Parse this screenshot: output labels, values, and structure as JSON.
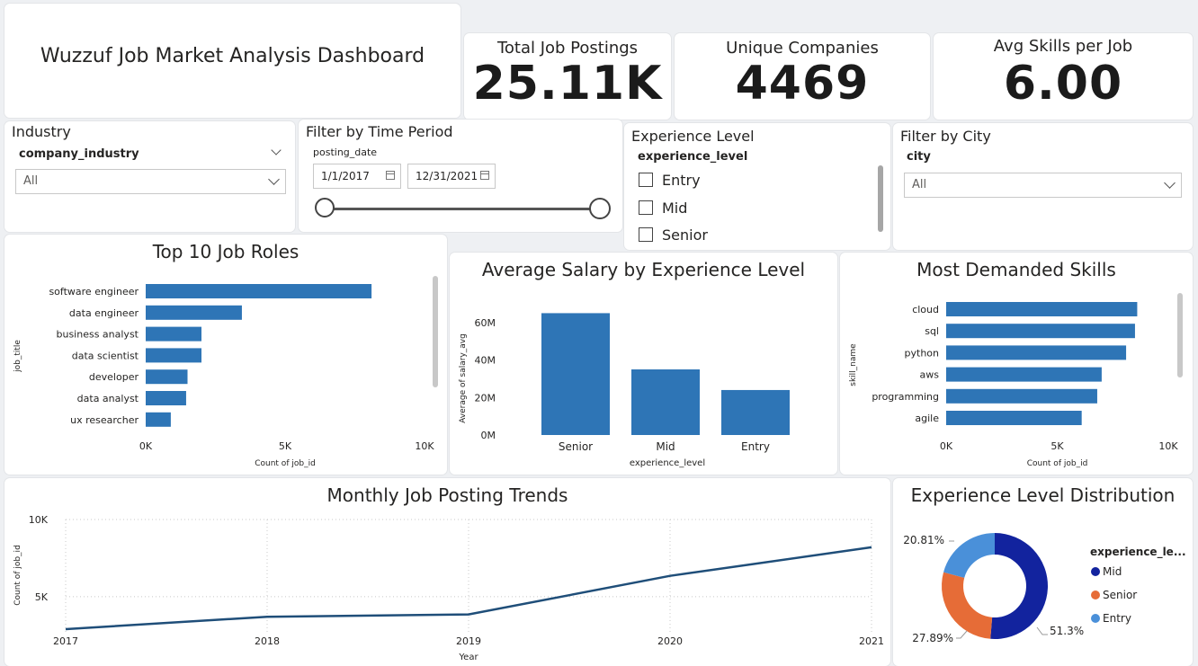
{
  "dashboard": {
    "title": "Wuzzuf Job Market Analysis Dashboard"
  },
  "kpis": [
    {
      "label": "Total Job Postings",
      "value": "25.11K"
    },
    {
      "label": "Unique Companies",
      "value": "4469"
    },
    {
      "label": "Avg Skills per Job",
      "value": "6.00"
    }
  ],
  "slicers": {
    "industry": {
      "title": "Industry",
      "field": "company_industry",
      "value": "All"
    },
    "time": {
      "title": "Filter by Time Period",
      "field": "posting_date",
      "start": "1/1/2017",
      "end": "12/31/2021"
    },
    "experience": {
      "title": "Experience Level",
      "field": "experience_level",
      "options": [
        "Entry",
        "Mid",
        "Senior"
      ]
    },
    "city": {
      "title": "Filter by City",
      "field": "city",
      "value": "All"
    }
  },
  "colors": {
    "bar": "#2e75b6",
    "line": "#1f4e79",
    "mid": "#12239e",
    "senior": "#e66c37",
    "entry": "#4a90d9"
  },
  "chart_data": [
    {
      "type": "bar",
      "orientation": "horizontal",
      "title": "Top 10 Job Roles",
      "xlabel": "Count of job_id",
      "ylabel": "job_title",
      "categories": [
        "software engineer",
        "data engineer",
        "business analyst",
        "data scientist",
        "developer",
        "data analyst",
        "ux researcher"
      ],
      "values": [
        8100,
        3450,
        2000,
        2000,
        1500,
        1450,
        900
      ],
      "xlim": [
        0,
        10000
      ],
      "xticks": [
        "0K",
        "5K",
        "10K"
      ]
    },
    {
      "type": "bar",
      "title": "Average Salary by Experience Level",
      "xlabel": "experience_level",
      "ylabel": "Average of salary_avg",
      "categories": [
        "Senior",
        "Mid",
        "Entry"
      ],
      "values": [
        65000000,
        35000000,
        24000000
      ],
      "ylim": [
        0,
        70000000
      ],
      "yticks": [
        "0M",
        "20M",
        "40M",
        "60M"
      ]
    },
    {
      "type": "bar",
      "orientation": "horizontal",
      "title": "Most Demanded Skills",
      "xlabel": "Count of job_id",
      "ylabel": "skill_name",
      "categories": [
        "cloud",
        "sql",
        "python",
        "aws",
        "programming",
        "agile"
      ],
      "values": [
        8600,
        8500,
        8100,
        7000,
        6800,
        6100
      ],
      "xlim": [
        0,
        10000
      ],
      "xticks": [
        "0K",
        "5K",
        "10K"
      ]
    },
    {
      "type": "line",
      "title": "Monthly Job Posting Trends",
      "xlabel": "Year",
      "ylabel": "Count of job_id",
      "x": [
        "2017",
        "2018",
        "2019",
        "2020",
        "2021"
      ],
      "values": [
        2900,
        3700,
        3850,
        6350,
        8200
      ],
      "ylim": [
        1500,
        10000
      ],
      "yticks": [
        "5K",
        "10K"
      ],
      "grid": true
    },
    {
      "type": "pie",
      "title": "Experience Level Distribution",
      "legend_title": "experience_le...",
      "categories": [
        "Mid",
        "Senior",
        "Entry"
      ],
      "values": [
        51.3,
        27.89,
        20.81
      ],
      "labels": [
        "51.3%",
        "27.89%",
        "20.81%"
      ],
      "legend_position": "right"
    }
  ]
}
